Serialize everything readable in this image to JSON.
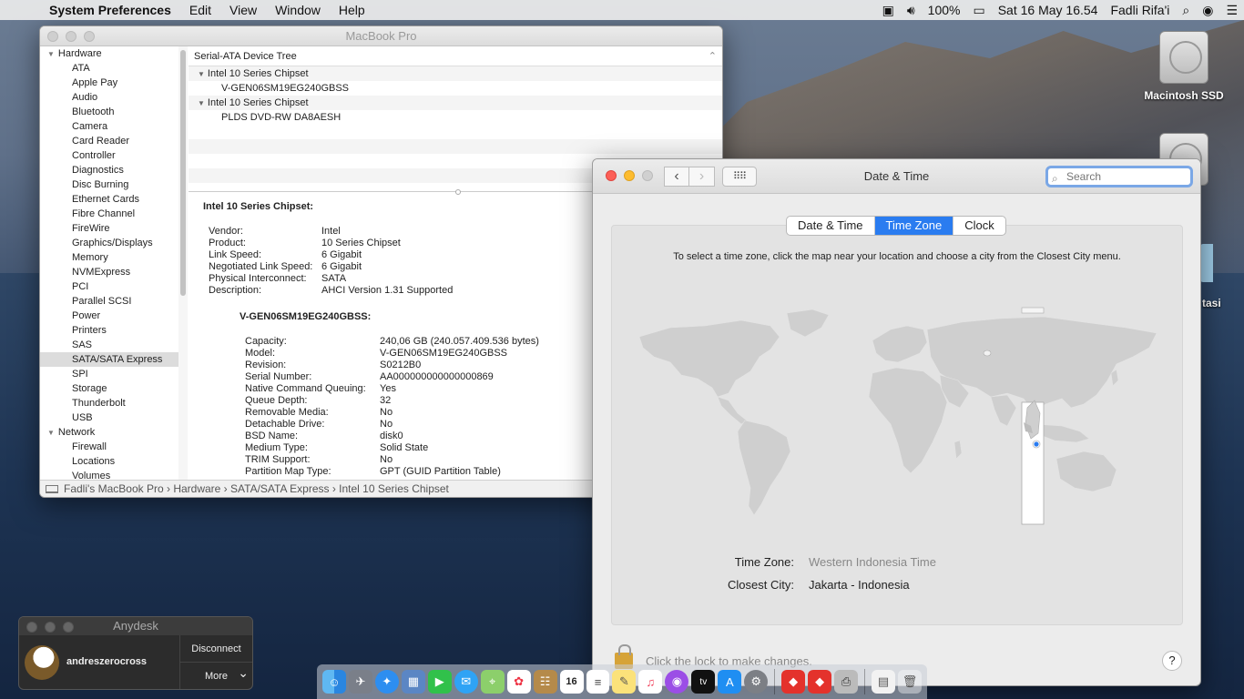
{
  "menubar": {
    "app": "System Preferences",
    "items": [
      "Edit",
      "View",
      "Window",
      "Help"
    ],
    "battery": "100%",
    "clock": "Sat 16 May  16.54",
    "user": "Fadli Rifa'i"
  },
  "desktop": {
    "disk1": "Macintosh SSD",
    "partial_label": "tasi"
  },
  "sysinfo": {
    "title": "MacBook Pro",
    "sidebar": {
      "group1": "Hardware",
      "hardware": [
        "ATA",
        "Apple Pay",
        "Audio",
        "Bluetooth",
        "Camera",
        "Card Reader",
        "Controller",
        "Diagnostics",
        "Disc Burning",
        "Ethernet Cards",
        "Fibre Channel",
        "FireWire",
        "Graphics/Displays",
        "Memory",
        "NVMExpress",
        "PCI",
        "Parallel SCSI",
        "Power",
        "Printers",
        "SAS",
        "SATA/SATA Express",
        "SPI",
        "Storage",
        "Thunderbolt",
        "USB"
      ],
      "group2": "Network",
      "network": [
        "Firewall",
        "Locations",
        "Volumes"
      ]
    },
    "tree": {
      "header": "Serial-ATA Device Tree",
      "rows": [
        {
          "text": "Intel 10 Series Chipset",
          "kind": "parent"
        },
        {
          "text": "V-GEN06SM19EG240GBSS",
          "kind": "child"
        },
        {
          "text": "Intel 10 Series Chipset",
          "kind": "parent"
        },
        {
          "text": "PLDS    DVD-RW DA8AESH",
          "kind": "child"
        }
      ]
    },
    "detail": {
      "heading": "Intel 10 Series Chipset:",
      "rows": [
        {
          "k": "Vendor:",
          "v": "Intel"
        },
        {
          "k": "Product:",
          "v": "10 Series Chipset"
        },
        {
          "k": "Link Speed:",
          "v": "6 Gigabit"
        },
        {
          "k": "Negotiated Link Speed:",
          "v": "6 Gigabit"
        },
        {
          "k": "Physical Interconnect:",
          "v": "SATA"
        },
        {
          "k": "Description:",
          "v": "AHCI Version 1.31 Supported"
        }
      ],
      "sub_heading": "V-GEN06SM19EG240GBSS:",
      "sub_rows": [
        {
          "k": "Capacity:",
          "v": "240,06 GB (240.057.409.536 bytes)"
        },
        {
          "k": "Model:",
          "v": "V-GEN06SM19EG240GBSS"
        },
        {
          "k": "Revision:",
          "v": "S0212B0"
        },
        {
          "k": "Serial Number:",
          "v": "AA000000000000000869"
        },
        {
          "k": "Native Command Queuing:",
          "v": "Yes"
        },
        {
          "k": "Queue Depth:",
          "v": "32"
        },
        {
          "k": "Removable Media:",
          "v": "No"
        },
        {
          "k": "Detachable Drive:",
          "v": "No"
        },
        {
          "k": "BSD Name:",
          "v": "disk0"
        },
        {
          "k": "Medium Type:",
          "v": "Solid State"
        },
        {
          "k": "TRIM Support:",
          "v": "No"
        },
        {
          "k": "Partition Map Type:",
          "v": "GPT (GUID Partition Table)"
        }
      ]
    },
    "breadcrumb": "Fadli's MacBook Pro  ›  Hardware  ›  SATA/SATA Express  ›  Intel 10 Series Chipset"
  },
  "datetime": {
    "title": "Date & Time",
    "search_placeholder": "Search",
    "tabs": [
      "Date & Time",
      "Time Zone",
      "Clock"
    ],
    "active_tab": 1,
    "hint": "To select a time zone, click the map near your location and choose a city from the Closest City menu.",
    "timezone_label": "Time Zone:",
    "timezone_value": "Western Indonesia Time",
    "city_label": "Closest City:",
    "city_value": "Jakarta - Indonesia",
    "lock_text": "Click the lock to make changes.",
    "help": "?"
  },
  "anydesk": {
    "title": "Anydesk",
    "user": "andreszerocross",
    "disconnect": "Disconnect",
    "more": "More"
  },
  "dock": {
    "apps": [
      "finder-icon",
      "launchpad-icon",
      "safari-icon",
      "preview-icon",
      "facetime-icon",
      "messages-icon",
      "maps-icon",
      "photos-icon",
      "contacts-icon",
      "calendar-icon",
      "reminders-icon",
      "notes-icon",
      "music-icon",
      "podcasts-icon",
      "tv-icon",
      "app-store-icon",
      "system-preferences-icon",
      "anydesk-icon",
      "anydesk-2-icon",
      "printer-icon"
    ],
    "calendar_day": "16"
  }
}
